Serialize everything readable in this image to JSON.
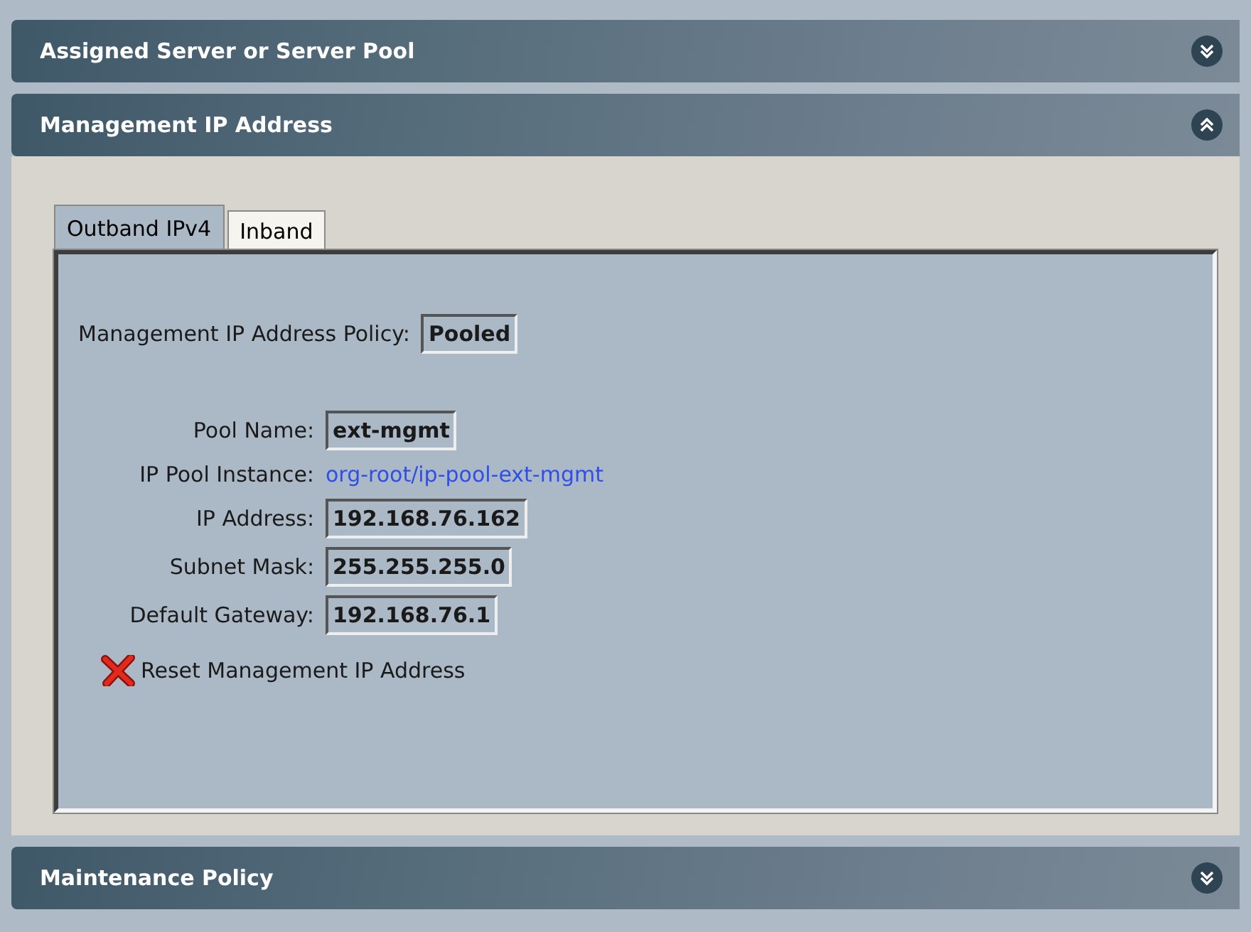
{
  "sections": [
    {
      "title": "Assigned Server or Server Pool",
      "expanded": false
    },
    {
      "title": "Management IP Address",
      "expanded": true,
      "tabs": [
        {
          "label": "Outband IPv4",
          "selected": true
        },
        {
          "label": "Inband",
          "selected": false
        }
      ],
      "policy": {
        "label": "Management IP Address Policy:",
        "value": "Pooled"
      },
      "fields": [
        {
          "kind": "field",
          "label": "Pool Name:",
          "value": "ext-mgmt"
        },
        {
          "kind": "link",
          "label": "IP Pool Instance:",
          "value": "org-root/ip-pool-ext-mgmt"
        },
        {
          "kind": "field",
          "label": "IP Address:",
          "value": "192.168.76.162"
        },
        {
          "kind": "field",
          "label": "Subnet Mask:",
          "value": "255.255.255.0"
        },
        {
          "kind": "field",
          "label": "Default Gateway:",
          "value": "192.168.76.1"
        }
      ],
      "action": "Reset Management IP Address"
    },
    {
      "title": "Maintenance Policy",
      "expanded": false
    }
  ]
}
